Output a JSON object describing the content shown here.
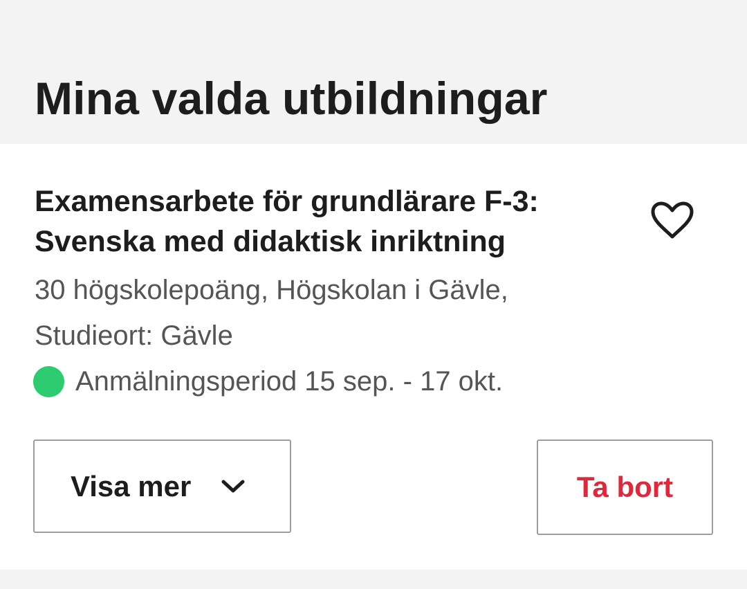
{
  "header": {
    "title": "Mina valda utbildningar"
  },
  "course": {
    "title_line1": "Examensarbete för grundlärare F-3:",
    "title_line2": "Svenska med didaktisk inriktning",
    "meta_line1": "30 högskolepoäng, Högskolan i Gävle,",
    "meta_line2": "Studieort: Gävle",
    "application_status": "Anmälningsperiod 15 sep. - 17 okt.",
    "favorite_icon": "heart-outline-icon"
  },
  "actions": {
    "show_more_label": "Visa mer",
    "show_more_icon": "chevron-down-icon",
    "remove_label": "Ta bort"
  },
  "colors": {
    "background": "#f3f3f3",
    "card": "#ffffff",
    "status_open": "#2ecc71",
    "remove_text": "#e0283c",
    "button_border": "#9d9d9d",
    "primary_text": "#1d1d1d",
    "secondary_text": "#555555"
  }
}
